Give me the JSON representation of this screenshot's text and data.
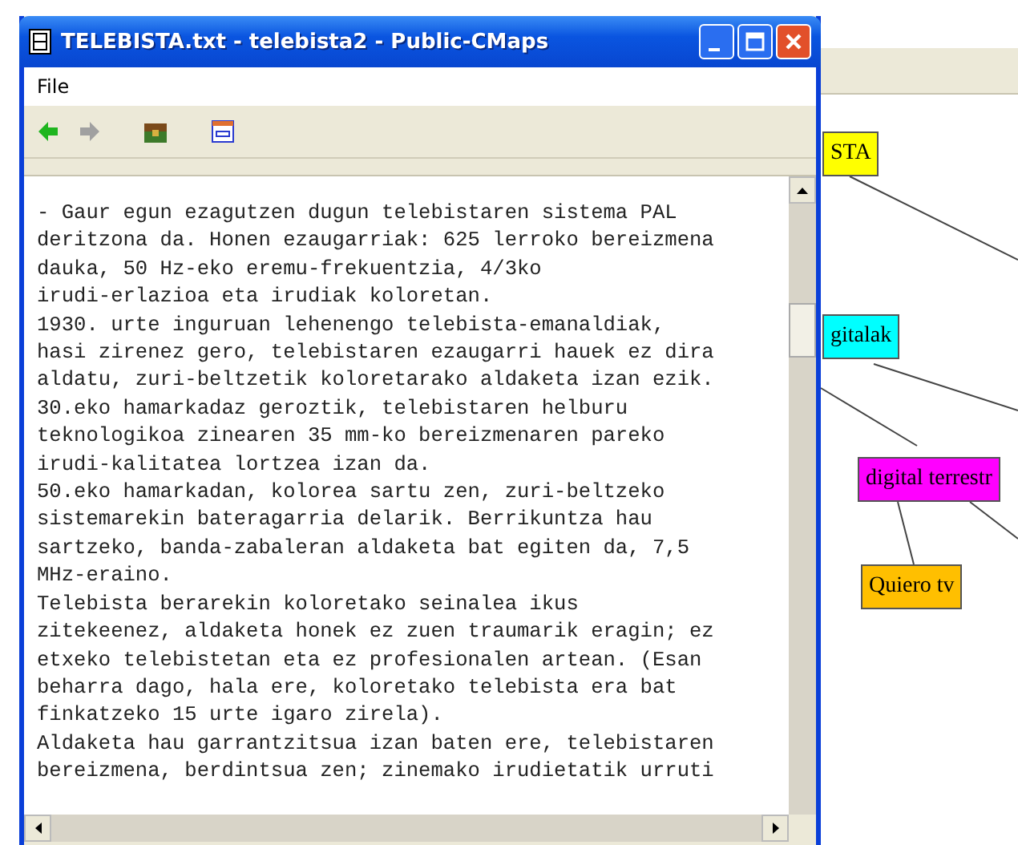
{
  "window": {
    "title": "TELEBISTA.txt - telebista2 - Public-CMaps"
  },
  "menu": [
    "File"
  ],
  "toolbar": [
    {
      "kind": "back",
      "disabled": false
    },
    {
      "kind": "forward",
      "disabled": true
    },
    {
      "kind": "box",
      "disabled": false
    },
    {
      "kind": "window",
      "disabled": false
    }
  ],
  "text_lines": [
    "- Gaur egun ezagutzen dugun telebistaren sistema PAL",
    "deritzona da. Honen ezaugarriak: 625 lerroko bereizmena",
    "dauka, 50 Hz-eko eremu-frekuentzia, 4/3ko",
    "irudi-erlazioa eta irudiak koloretan.",
    "1930. urte inguruan lehenengo telebista-emanaldiak,",
    "hasi zirenez gero, telebistaren ezaugarri hauek ez dira",
    "aldatu, zuri-beltzetik koloretarako aldaketa izan ezik.",
    "30.eko hamarkadaz geroztik, telebistaren helburu",
    "teknologikoa zinearen 35 mm-ko bereizmenaren pareko",
    "irudi-kalitatea lortzea izan da.",
    "50.eko hamarkadan, kolorea sartu zen, zuri-beltzeko",
    "sistemarekin bateragarria delarik. Berrikuntza hau",
    "sartzeko, banda-zabaleran aldaketa bat egiten da, 7,5",
    "MHz-eraino.",
    "Telebista berarekin koloretako seinalea ikus",
    "zitekeenez, aldaketa honek ez zuen traumarik eragin; ez",
    "etxeko telebistetan eta ez profesionalen artean. (Esan",
    "beharra dago, hala ere, koloretako telebista era bat",
    "finkatzeko 15 urte igaro zirela).",
    "Aldaketa hau garrantzitsua izan baten ere, telebistaren",
    "bereizmena, berdintsua zen; zinemako irudietatik urruti"
  ],
  "concept_map": {
    "nodes": [
      {
        "label": "STA",
        "color": "#ffff00"
      },
      {
        "label": "gitalak",
        "color": "#00ffff"
      },
      {
        "label": "digital terrestr",
        "color": "#ff00ff"
      },
      {
        "label": "Quiero tv",
        "color": "#ffbf00"
      }
    ]
  }
}
